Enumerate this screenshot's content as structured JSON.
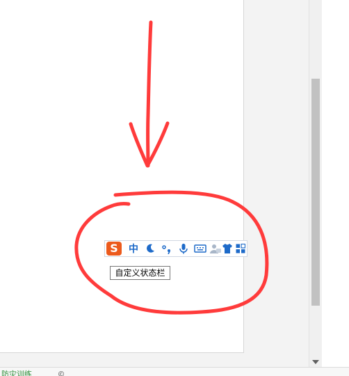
{
  "ime_toolbar": {
    "logo_letter": "S",
    "mode_label": "中",
    "tooltip": "自定义状态栏"
  },
  "status_bar": {
    "items": [
      "防灾训练",
      "©",
      "            "
    ]
  },
  "colors": {
    "annotation": "#ff3b3b",
    "ime_blue": "#1d6ac9",
    "sogou_orange": "#ec5a1c"
  }
}
